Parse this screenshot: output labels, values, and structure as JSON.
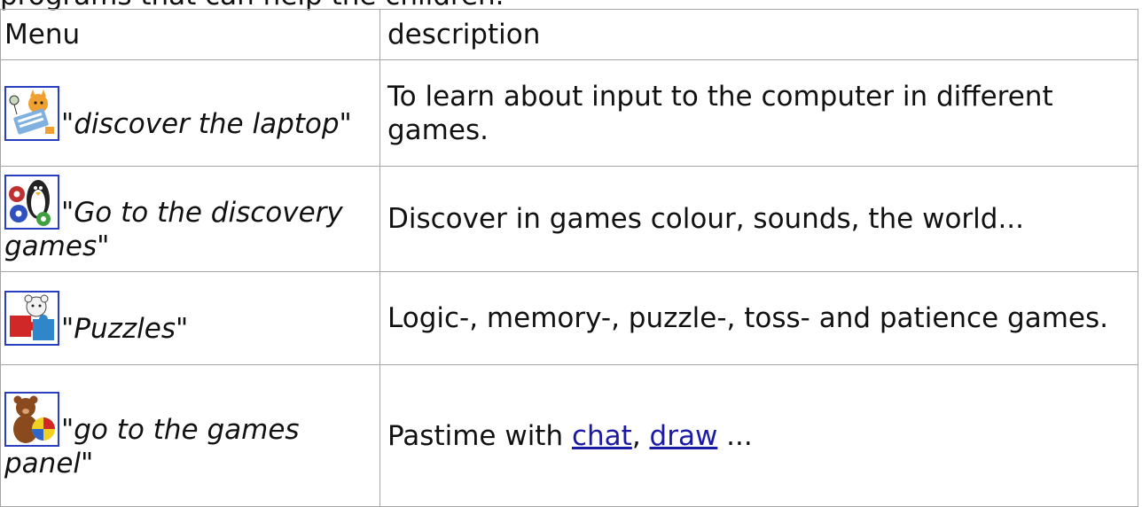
{
  "intro_text": "programs that can help the children.",
  "table": {
    "header": {
      "menu": "Menu",
      "description": "description"
    },
    "rows": [
      {
        "icon": "cat-keyboard-icon",
        "menu_label": "\"discover the laptop\"",
        "description": "To learn about input to the computer in different games."
      },
      {
        "icon": "penguin-gears-icon",
        "menu_label": "\"Go to the discovery games\"",
        "description": "Discover in games colour, sounds, the world..."
      },
      {
        "icon": "bear-puzzle-icon",
        "menu_label": "\"Puzzles\"",
        "description": "Logic-, memory-, puzzle-, toss- and patience games."
      },
      {
        "icon": "teddy-ball-icon",
        "menu_label": "\"go to the games panel\"",
        "description_prefix": "Pastime with ",
        "link_chat": "chat",
        "separator": ", ",
        "link_draw": "draw",
        "description_suffix": " ..."
      }
    ]
  },
  "colors": {
    "border": "#a6a6a6",
    "icon_border": "#2a3fbf",
    "link": "#1a1aa6"
  }
}
